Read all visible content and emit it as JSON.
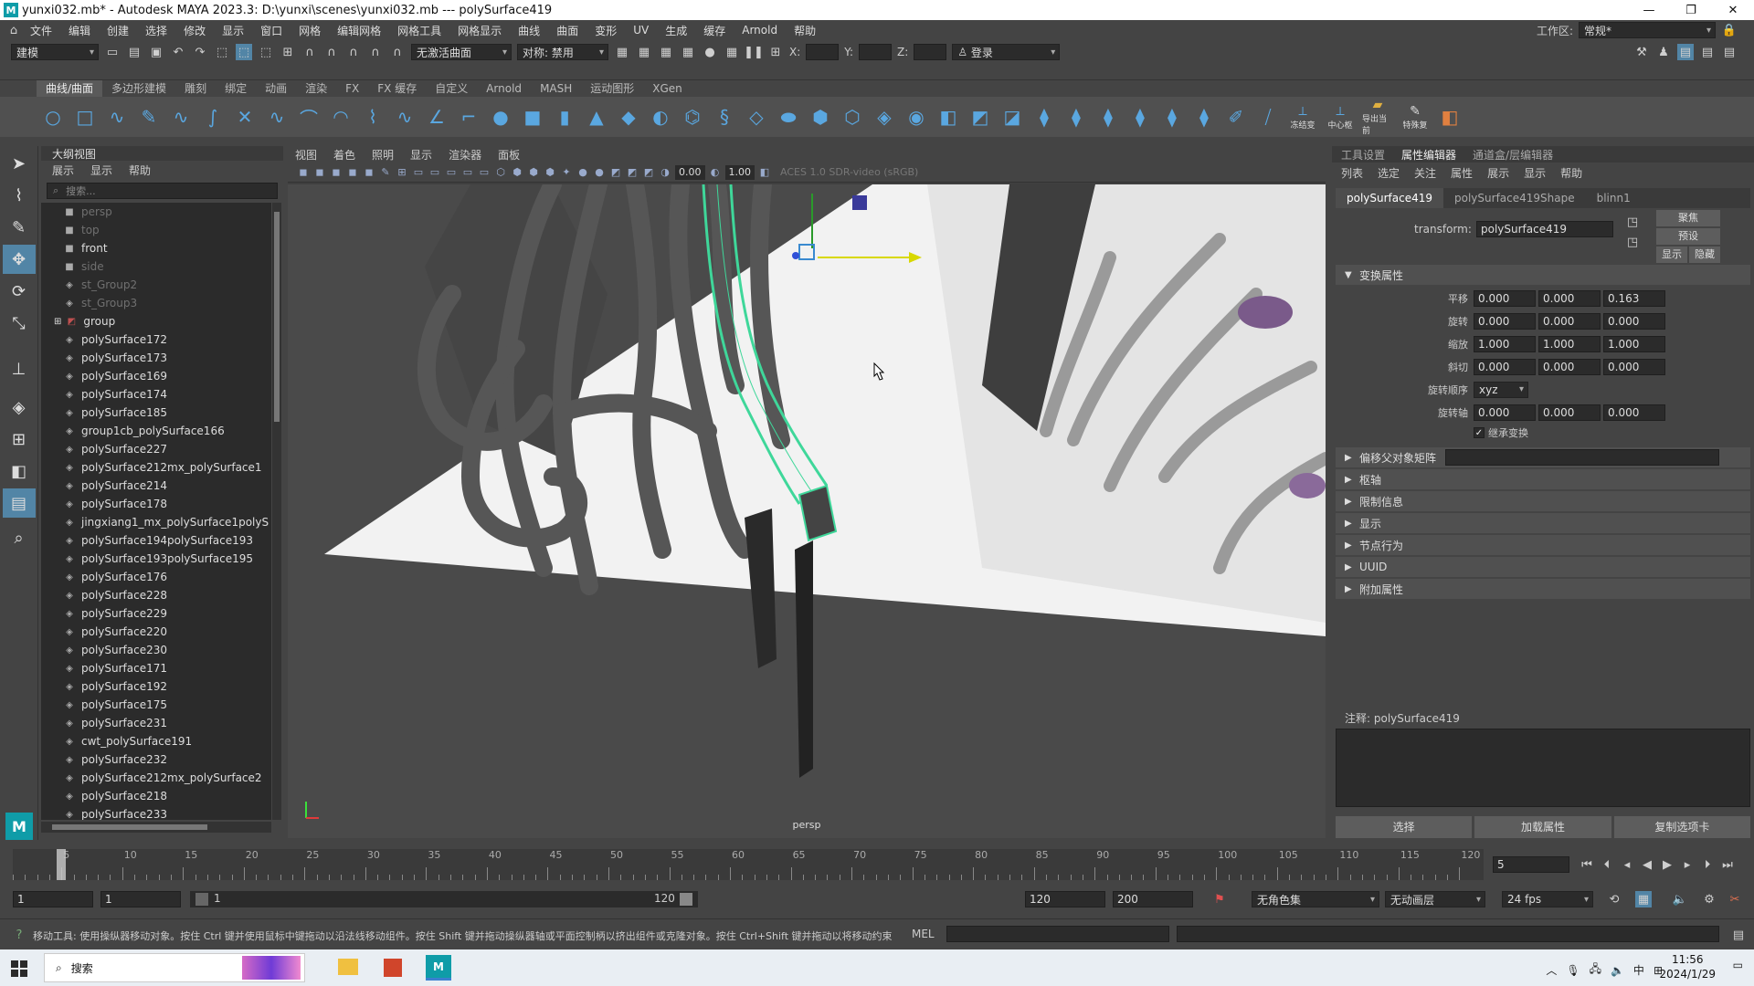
{
  "window": {
    "title": "yunxi032.mb* - Autodesk MAYA 2023.3: D:\\yunxi\\scenes\\yunxi032.mb  ---  polySurface419",
    "logo": "M"
  },
  "menu": {
    "items": [
      "文件",
      "编辑",
      "创建",
      "选择",
      "修改",
      "显示",
      "窗口",
      "网格",
      "编辑网格",
      "网格工具",
      "网格显示",
      "曲线",
      "曲面",
      "变形",
      "UV",
      "生成",
      "缓存",
      "Arnold",
      "帮助"
    ],
    "workspace_label": "工作区:",
    "workspace_value": "常规*"
  },
  "status": {
    "mode": "建模",
    "live_surface": "无激活曲面",
    "symmetry": "对称: 禁用",
    "x_label": "X:",
    "y_label": "Y:",
    "z_label": "Z:",
    "login": "登录"
  },
  "shelf": {
    "tabs": [
      "曲线/曲面",
      "多边形建模",
      "雕刻",
      "绑定",
      "动画",
      "渲染",
      "FX",
      "FX 缓存",
      "自定义",
      "Arnold",
      "MASH",
      "运动图形",
      "XGen"
    ],
    "active_tab": "曲线/曲面",
    "extra_labels": [
      "冻结变",
      "中心枢",
      "导出当前",
      "特殊复"
    ]
  },
  "outliner": {
    "title": "大纲视图",
    "menu": [
      "展示",
      "显示",
      "帮助"
    ],
    "search_placeholder": "搜索...",
    "items": [
      {
        "name": "persp",
        "type": "camera",
        "dim": true
      },
      {
        "name": "top",
        "type": "camera",
        "dim": true
      },
      {
        "name": "front",
        "type": "camera",
        "dim": false
      },
      {
        "name": "side",
        "type": "camera",
        "dim": true
      },
      {
        "name": "st_Group2",
        "type": "mesh",
        "dim": true
      },
      {
        "name": "st_Group3",
        "type": "mesh",
        "dim": true
      },
      {
        "name": "group",
        "type": "group",
        "dim": false
      },
      {
        "name": "polySurface172",
        "type": "mesh",
        "dim": false
      },
      {
        "name": "polySurface173",
        "type": "mesh",
        "dim": false
      },
      {
        "name": "polySurface169",
        "type": "mesh",
        "dim": false
      },
      {
        "name": "polySurface174",
        "type": "mesh",
        "dim": false
      },
      {
        "name": "polySurface185",
        "type": "mesh",
        "dim": false
      },
      {
        "name": "group1cb_polySurface166",
        "type": "mesh",
        "dim": false
      },
      {
        "name": "polySurface227",
        "type": "mesh",
        "dim": false
      },
      {
        "name": "polySurface212mx_polySurface1",
        "type": "mesh",
        "dim": false
      },
      {
        "name": "polySurface214",
        "type": "mesh",
        "dim": false
      },
      {
        "name": "polySurface178",
        "type": "mesh",
        "dim": false
      },
      {
        "name": "jingxiang1_mx_polySurface1polyS",
        "type": "mesh",
        "dim": false
      },
      {
        "name": "polySurface194polySurface193",
        "type": "mesh",
        "dim": false
      },
      {
        "name": "polySurface193polySurface195",
        "type": "mesh",
        "dim": false
      },
      {
        "name": "polySurface176",
        "type": "mesh",
        "dim": false
      },
      {
        "name": "polySurface228",
        "type": "mesh",
        "dim": false
      },
      {
        "name": "polySurface229",
        "type": "mesh",
        "dim": false
      },
      {
        "name": "polySurface220",
        "type": "mesh",
        "dim": false
      },
      {
        "name": "polySurface230",
        "type": "mesh",
        "dim": false
      },
      {
        "name": "polySurface171",
        "type": "mesh",
        "dim": false
      },
      {
        "name": "polySurface192",
        "type": "mesh",
        "dim": false
      },
      {
        "name": "polySurface175",
        "type": "mesh",
        "dim": false
      },
      {
        "name": "polySurface231",
        "type": "mesh",
        "dim": false
      },
      {
        "name": "cwt_polySurface191",
        "type": "mesh",
        "dim": false
      },
      {
        "name": "polySurface232",
        "type": "mesh",
        "dim": false
      },
      {
        "name": "polySurface212mx_polySurface2",
        "type": "mesh",
        "dim": false
      },
      {
        "name": "polySurface218",
        "type": "mesh",
        "dim": false
      },
      {
        "name": "polySurface233",
        "type": "mesh",
        "dim": false
      }
    ]
  },
  "viewport": {
    "menu": [
      "视图",
      "着色",
      "照明",
      "显示",
      "渲染器",
      "面板"
    ],
    "exposure": "0.00",
    "gamma": "1.00",
    "colorspace": "ACES 1.0 SDR-video (sRGB)",
    "camera": "persp"
  },
  "attribute_editor": {
    "tabs": [
      "工具设置",
      "属性编辑器",
      "通道盒/层编辑器"
    ],
    "active_tab": "属性编辑器",
    "menu": [
      "列表",
      "选定",
      "关注",
      "属性",
      "展示",
      "显示",
      "帮助"
    ],
    "node_tabs": [
      "polySurface419",
      "polySurface419Shape",
      "blinn1"
    ],
    "transform_label": "transform:",
    "transform_value": "polySurface419",
    "side_buttons": [
      "聚焦",
      "预设",
      "显示",
      "隐藏"
    ],
    "section_title": "变换属性",
    "rows": [
      {
        "label": "平移",
        "values": [
          "0.000",
          "0.000",
          "0.163"
        ]
      },
      {
        "label": "旋转",
        "values": [
          "0.000",
          "0.000",
          "0.000"
        ]
      },
      {
        "label": "缩放",
        "values": [
          "1.000",
          "1.000",
          "1.000"
        ]
      },
      {
        "label": "斜切",
        "values": [
          "0.000",
          "0.000",
          "0.000"
        ]
      }
    ],
    "rotate_order_label": "旋转顺序",
    "rotate_order": "xyz",
    "rotate_axis_label": "旋转轴",
    "rotate_axis": [
      "0.000",
      "0.000",
      "0.000"
    ],
    "inherit_label": "继承变换",
    "collapsed_sections": [
      "偏移父对象矩阵",
      "枢轴",
      "限制信息",
      "显示",
      "节点行为",
      "UUID",
      "附加属性"
    ],
    "notes_label": "注释: polySurface419",
    "bottom_buttons": [
      "选择",
      "加载属性",
      "复制选项卡"
    ]
  },
  "timeline": {
    "ticks": [
      "5",
      "10",
      "15",
      "20",
      "25",
      "30",
      "35",
      "40",
      "45",
      "50",
      "55",
      "60",
      "65",
      "70",
      "75",
      "80",
      "85",
      "90",
      "95",
      "100",
      "105",
      "110",
      "115",
      "120"
    ],
    "current_frame": "5"
  },
  "range": {
    "start": "1",
    "start2": "1",
    "slider_start": "1",
    "slider_end": "120",
    "end": "120",
    "end2": "200",
    "character_set": "无角色集",
    "anim_layer": "无动画层",
    "fps": "24 fps"
  },
  "command": {
    "help_text": "移动工具: 使用操纵器移动对象。按住 Ctrl 键并使用鼠标中键拖动以沿法线移动组件。按住 Shift 键并拖动操纵器轴或平面控制柄以挤出组件或克隆对象。按住 Ctrl+Shift 键并拖动以将移动约束",
    "lang": "MEL"
  },
  "taskbar": {
    "search": "搜索",
    "time": "11:56",
    "date": "2024/1/29",
    "ime": "中"
  }
}
